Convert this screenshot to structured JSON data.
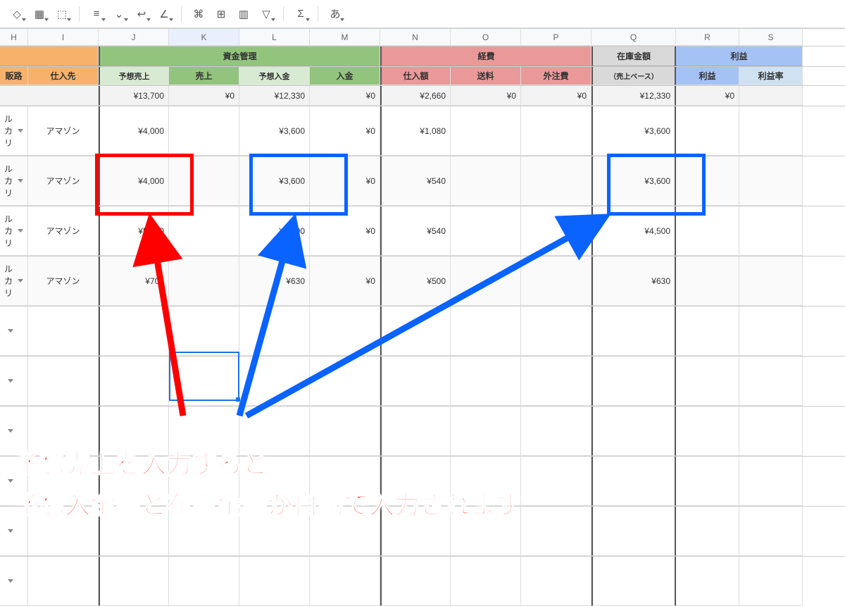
{
  "toolbar": {
    "fill": "◆",
    "borders": "▦",
    "merge": "⬚",
    "halign": "≡",
    "valign": "⌄",
    "wrap": "↩",
    "rotate": "∠",
    "link": "🔗",
    "comment": "▭",
    "chart": "▥",
    "filter": "▽",
    "sigma": "Σ",
    "lang": "あ"
  },
  "columns": [
    "H",
    "I",
    "J",
    "K",
    "L",
    "M",
    "N",
    "O",
    "P",
    "Q",
    "R",
    "S"
  ],
  "groups": {
    "shikin": "資金管理",
    "keihi": "経費",
    "zaiko": "在庫金額",
    "rieki": "利益"
  },
  "subheads": {
    "hanro": "販路",
    "shiiresaki": "仕入先",
    "yoso_uriage": "予想売上",
    "uriage": "売上",
    "yoso_nyukin": "予想入金",
    "nyukin": "入金",
    "shiiregaku": "仕入額",
    "souryou": "送料",
    "gaichuu": "外注費",
    "zaiko_sub": "（売上ベース）",
    "rieki": "利益",
    "riekiritsu": "利益率"
  },
  "totals": {
    "yoso_uriage": "¥13,700",
    "uriage": "¥0",
    "yoso_nyukin": "¥12,330",
    "nyukin": "¥0",
    "shiiregaku": "¥2,660",
    "souryou": "¥0",
    "gaichuu": "¥0",
    "zaiko": "¥12,330",
    "rieki": "¥0"
  },
  "rows": [
    {
      "hanro": "ルカリ",
      "vendor": "アマゾン",
      "j": "¥4,000",
      "l": "¥3,600",
      "m": "¥0",
      "n": "¥1,080",
      "q": "¥3,600"
    },
    {
      "hanro": "ルカリ",
      "vendor": "アマゾン",
      "j": "¥4,000",
      "l": "¥3,600",
      "m": "¥0",
      "n": "¥540",
      "q": "¥3,600"
    },
    {
      "hanro": "ルカリ",
      "vendor": "アマゾン",
      "j": "¥5,000",
      "l": "¥4,500",
      "m": "¥0",
      "n": "¥540",
      "q": "¥4,500"
    },
    {
      "hanro": "ルカリ",
      "vendor": "アマゾン",
      "j": "¥700",
      "l": "¥630",
      "m": "¥0",
      "n": "¥500",
      "q": "¥630"
    }
  ],
  "annotation": {
    "line1": "予想売上を入力すると",
    "line2": "予想入金額と在庫金額が自動で入力されます"
  }
}
